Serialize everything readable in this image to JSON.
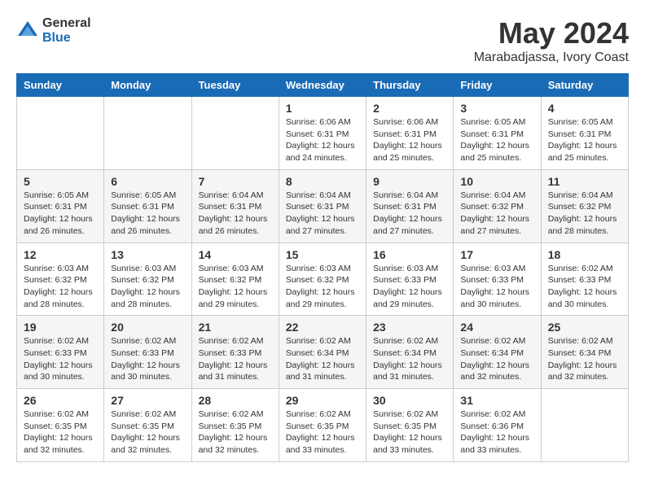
{
  "header": {
    "logo_general": "General",
    "logo_blue": "Blue",
    "title": "May 2024",
    "subtitle": "Marabadjassa, Ivory Coast"
  },
  "days_of_week": [
    "Sunday",
    "Monday",
    "Tuesday",
    "Wednesday",
    "Thursday",
    "Friday",
    "Saturday"
  ],
  "weeks": [
    [
      {
        "day": "",
        "info": ""
      },
      {
        "day": "",
        "info": ""
      },
      {
        "day": "",
        "info": ""
      },
      {
        "day": "1",
        "info": "Sunrise: 6:06 AM\nSunset: 6:31 PM\nDaylight: 12 hours\nand 24 minutes."
      },
      {
        "day": "2",
        "info": "Sunrise: 6:06 AM\nSunset: 6:31 PM\nDaylight: 12 hours\nand 25 minutes."
      },
      {
        "day": "3",
        "info": "Sunrise: 6:05 AM\nSunset: 6:31 PM\nDaylight: 12 hours\nand 25 minutes."
      },
      {
        "day": "4",
        "info": "Sunrise: 6:05 AM\nSunset: 6:31 PM\nDaylight: 12 hours\nand 25 minutes."
      }
    ],
    [
      {
        "day": "5",
        "info": "Sunrise: 6:05 AM\nSunset: 6:31 PM\nDaylight: 12 hours\nand 26 minutes."
      },
      {
        "day": "6",
        "info": "Sunrise: 6:05 AM\nSunset: 6:31 PM\nDaylight: 12 hours\nand 26 minutes."
      },
      {
        "day": "7",
        "info": "Sunrise: 6:04 AM\nSunset: 6:31 PM\nDaylight: 12 hours\nand 26 minutes."
      },
      {
        "day": "8",
        "info": "Sunrise: 6:04 AM\nSunset: 6:31 PM\nDaylight: 12 hours\nand 27 minutes."
      },
      {
        "day": "9",
        "info": "Sunrise: 6:04 AM\nSunset: 6:31 PM\nDaylight: 12 hours\nand 27 minutes."
      },
      {
        "day": "10",
        "info": "Sunrise: 6:04 AM\nSunset: 6:32 PM\nDaylight: 12 hours\nand 27 minutes."
      },
      {
        "day": "11",
        "info": "Sunrise: 6:04 AM\nSunset: 6:32 PM\nDaylight: 12 hours\nand 28 minutes."
      }
    ],
    [
      {
        "day": "12",
        "info": "Sunrise: 6:03 AM\nSunset: 6:32 PM\nDaylight: 12 hours\nand 28 minutes."
      },
      {
        "day": "13",
        "info": "Sunrise: 6:03 AM\nSunset: 6:32 PM\nDaylight: 12 hours\nand 28 minutes."
      },
      {
        "day": "14",
        "info": "Sunrise: 6:03 AM\nSunset: 6:32 PM\nDaylight: 12 hours\nand 29 minutes."
      },
      {
        "day": "15",
        "info": "Sunrise: 6:03 AM\nSunset: 6:32 PM\nDaylight: 12 hours\nand 29 minutes."
      },
      {
        "day": "16",
        "info": "Sunrise: 6:03 AM\nSunset: 6:33 PM\nDaylight: 12 hours\nand 29 minutes."
      },
      {
        "day": "17",
        "info": "Sunrise: 6:03 AM\nSunset: 6:33 PM\nDaylight: 12 hours\nand 30 minutes."
      },
      {
        "day": "18",
        "info": "Sunrise: 6:02 AM\nSunset: 6:33 PM\nDaylight: 12 hours\nand 30 minutes."
      }
    ],
    [
      {
        "day": "19",
        "info": "Sunrise: 6:02 AM\nSunset: 6:33 PM\nDaylight: 12 hours\nand 30 minutes."
      },
      {
        "day": "20",
        "info": "Sunrise: 6:02 AM\nSunset: 6:33 PM\nDaylight: 12 hours\nand 30 minutes."
      },
      {
        "day": "21",
        "info": "Sunrise: 6:02 AM\nSunset: 6:33 PM\nDaylight: 12 hours\nand 31 minutes."
      },
      {
        "day": "22",
        "info": "Sunrise: 6:02 AM\nSunset: 6:34 PM\nDaylight: 12 hours\nand 31 minutes."
      },
      {
        "day": "23",
        "info": "Sunrise: 6:02 AM\nSunset: 6:34 PM\nDaylight: 12 hours\nand 31 minutes."
      },
      {
        "day": "24",
        "info": "Sunrise: 6:02 AM\nSunset: 6:34 PM\nDaylight: 12 hours\nand 32 minutes."
      },
      {
        "day": "25",
        "info": "Sunrise: 6:02 AM\nSunset: 6:34 PM\nDaylight: 12 hours\nand 32 minutes."
      }
    ],
    [
      {
        "day": "26",
        "info": "Sunrise: 6:02 AM\nSunset: 6:35 PM\nDaylight: 12 hours\nand 32 minutes."
      },
      {
        "day": "27",
        "info": "Sunrise: 6:02 AM\nSunset: 6:35 PM\nDaylight: 12 hours\nand 32 minutes."
      },
      {
        "day": "28",
        "info": "Sunrise: 6:02 AM\nSunset: 6:35 PM\nDaylight: 12 hours\nand 32 minutes."
      },
      {
        "day": "29",
        "info": "Sunrise: 6:02 AM\nSunset: 6:35 PM\nDaylight: 12 hours\nand 33 minutes."
      },
      {
        "day": "30",
        "info": "Sunrise: 6:02 AM\nSunset: 6:35 PM\nDaylight: 12 hours\nand 33 minutes."
      },
      {
        "day": "31",
        "info": "Sunrise: 6:02 AM\nSunset: 6:36 PM\nDaylight: 12 hours\nand 33 minutes."
      },
      {
        "day": "",
        "info": ""
      }
    ]
  ]
}
